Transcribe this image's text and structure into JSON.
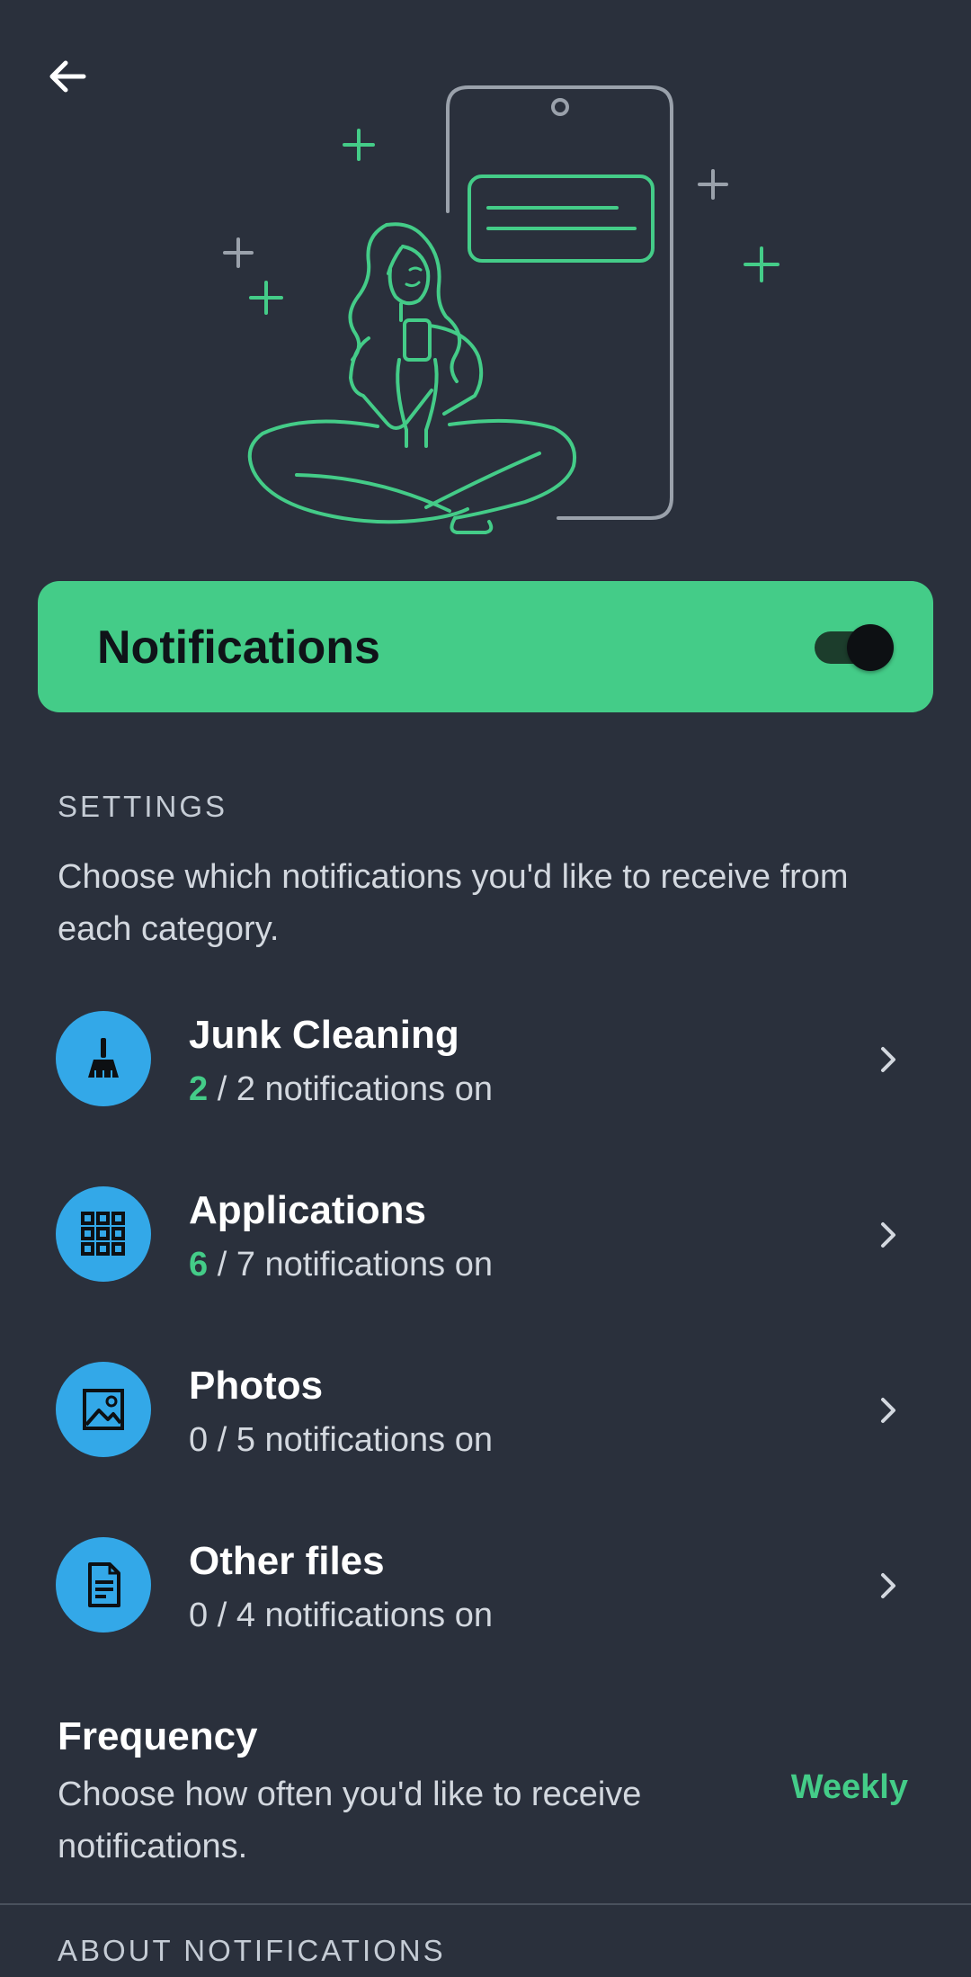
{
  "header": {
    "back_icon": "arrow-left-icon"
  },
  "master_toggle": {
    "label": "Notifications",
    "enabled": true
  },
  "settings": {
    "section_label": "SETTINGS",
    "description": "Choose which notifications you'd like to receive from each category."
  },
  "categories": [
    {
      "name": "Junk Cleaning",
      "on": "2",
      "rest": " / 2 notifications on",
      "icon": "broom-icon",
      "highlight": true
    },
    {
      "name": "Applications",
      "on": "6",
      "rest": " / 7 notifications on",
      "icon": "apps-grid-icon",
      "highlight": true
    },
    {
      "name": "Photos",
      "on": "0",
      "rest": " / 5 notifications on",
      "icon": "image-icon",
      "highlight": false
    },
    {
      "name": "Other files",
      "on": "0",
      "rest": " / 4 notifications on",
      "icon": "document-icon",
      "highlight": false
    }
  ],
  "frequency": {
    "title": "Frequency",
    "description": "Choose how often you'd like to receive notifications.",
    "value": "Weekly"
  },
  "about": {
    "section_label": "ABOUT NOTIFICATIONS"
  },
  "colors": {
    "background": "#2a303c",
    "accent": "#44cc88",
    "icon_bg": "#33a8e8"
  }
}
